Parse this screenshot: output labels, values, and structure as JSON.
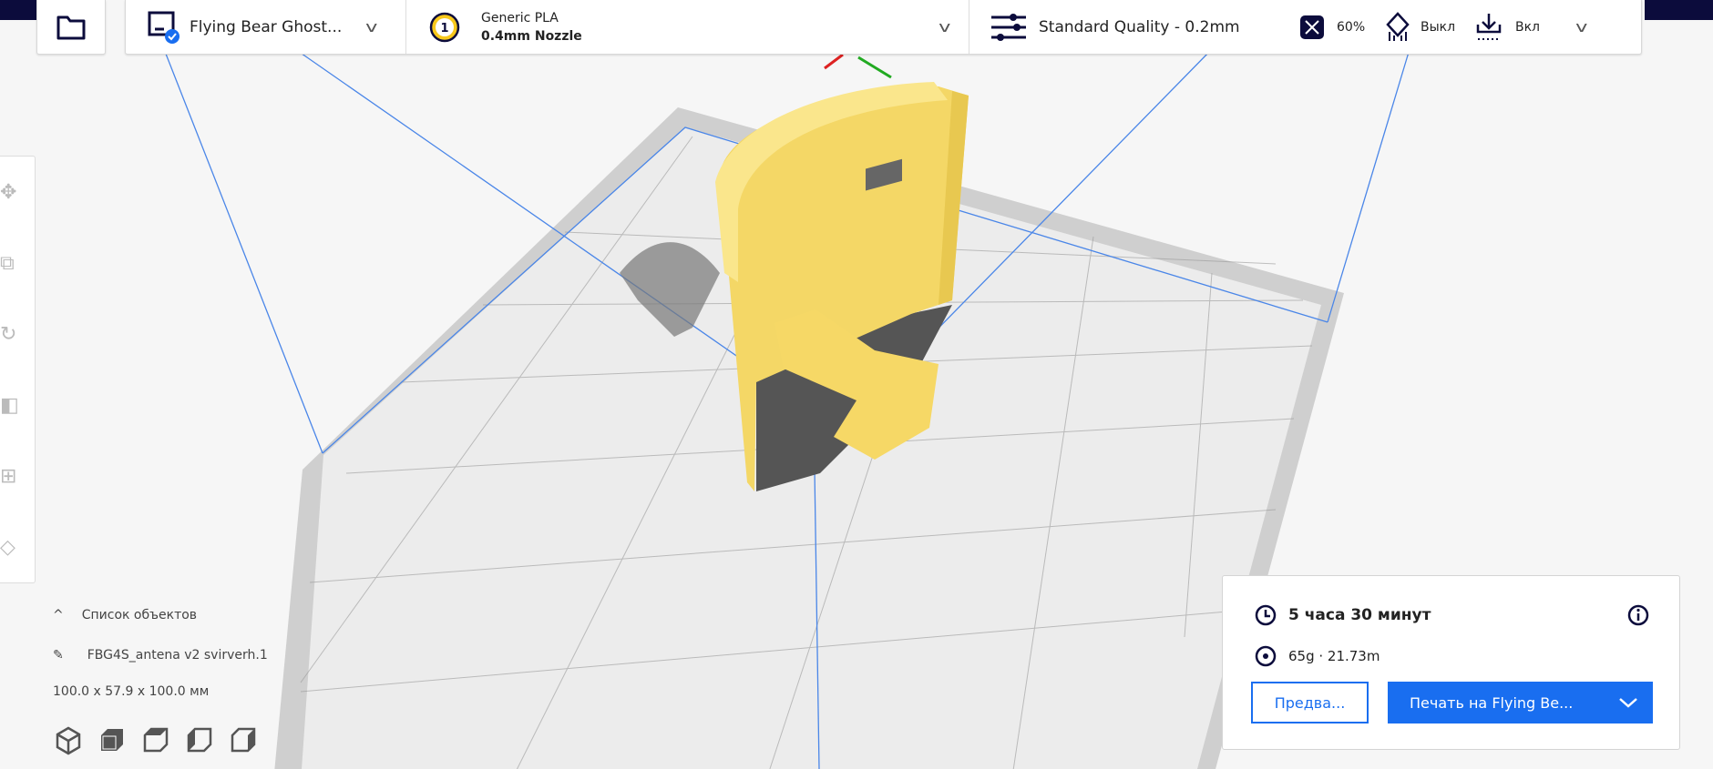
{
  "toolbar": {
    "printer": "Flying Bear Ghost...",
    "extruder_number": "1",
    "material": "Generic PLA",
    "nozzle": "0.4mm Nozzle",
    "profile": "Standard Quality - 0.2mm",
    "infill": "60%",
    "support": "Выкл",
    "adhesion": "Вкл"
  },
  "objects": {
    "header": "Список объектов",
    "name": "FBG4S_antena v2 svirverh.1",
    "dimensions": "100.0 x 57.9 x 100.0 мм"
  },
  "print_panel": {
    "time": "5 часа 30 минут",
    "material_usage": "65g · 21.73m",
    "preview_label": "Предва...",
    "print_label": "Печать на Flying Be..."
  },
  "colors": {
    "accent": "#196ef0",
    "navy": "#0c0c3c",
    "model": "#f8de6c"
  }
}
